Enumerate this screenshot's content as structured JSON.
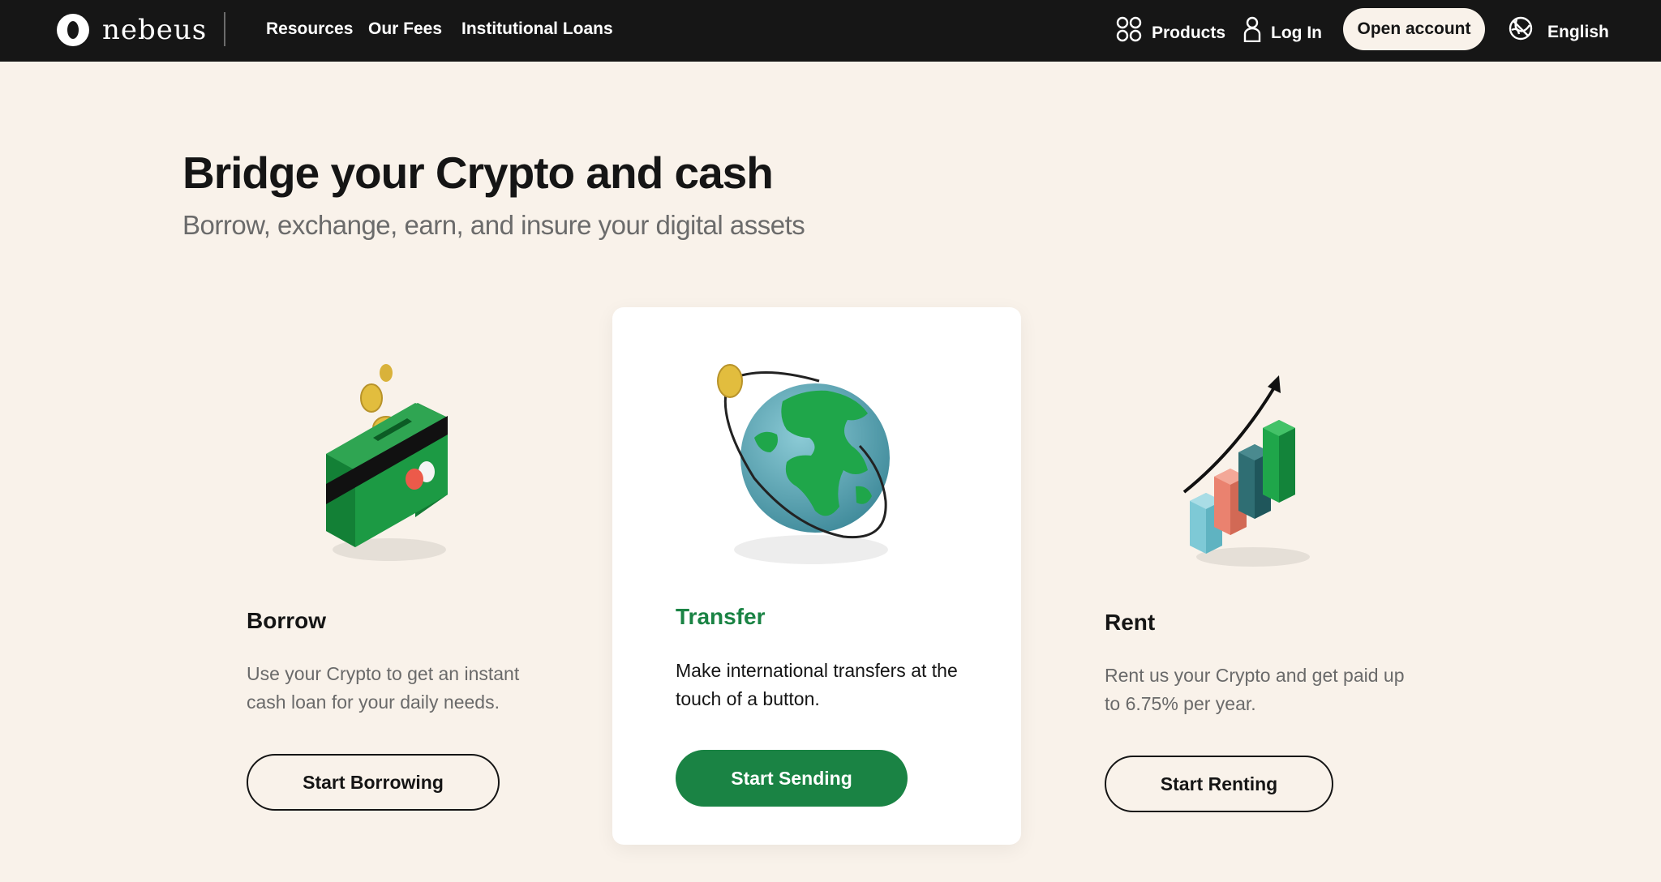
{
  "header": {
    "brand": "nebeus",
    "nav": [
      "Resources",
      "Our Fees",
      "Institutional Loans"
    ],
    "products_label": "Products",
    "login_label": "Log In",
    "open_account_label": "Open account",
    "language_label": "English",
    "icons": {
      "products": "grid-icon",
      "login": "user-icon",
      "language": "globe-icon"
    }
  },
  "hero": {
    "title": "Bridge your Crypto and cash",
    "subtitle": "Borrow, exchange, earn, and insure your digital assets"
  },
  "cards": [
    {
      "title": "Borrow",
      "description": "Use your Crypto to get an instant cash loan for your daily needs.",
      "button": "Start Borrowing",
      "illustration": "wallet-with-coins"
    },
    {
      "title": "Transfer",
      "description": "Make international transfers at the touch of a button.",
      "button": "Start Sending",
      "illustration": "globe-with-coin"
    },
    {
      "title": "Rent",
      "description": "Rent us your Crypto and get paid up to 6.75% per year.",
      "button": "Start Renting",
      "illustration": "growth-bar-chart"
    }
  ],
  "colors": {
    "header_bg": "#161616",
    "page_bg": "#f9f2ea",
    "accent_green": "#1a8344",
    "text_dark": "#151515",
    "text_muted": "#6a6a6a"
  }
}
